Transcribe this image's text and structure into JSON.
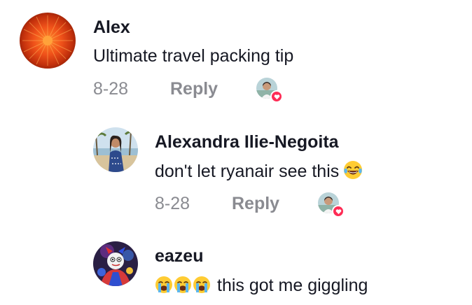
{
  "comments": [
    {
      "username": "Alex",
      "text": "Ultimate travel packing tip",
      "date": "8-28",
      "reply_label": "Reply",
      "avatar": "orange-flower-avatar",
      "liked_by_creator": true
    },
    {
      "username": "Alexandra Ilie-Negoita",
      "text": "don't let ryanair see this",
      "trailing_emoji": "laughing-crying-emoji",
      "date": "8-28",
      "reply_label": "Reply",
      "avatar": "beach-photo-avatar",
      "liked_by_creator": true
    },
    {
      "username": "eazeu",
      "leading_emojis": [
        "crying-emoji",
        "crying-emoji",
        "crying-emoji"
      ],
      "text": "this got me giggling",
      "avatar": "cartoon-character-avatar"
    }
  ],
  "colors": {
    "text": "#161823",
    "secondary": "#8a8b91",
    "like_badge": "#fe2c55"
  }
}
